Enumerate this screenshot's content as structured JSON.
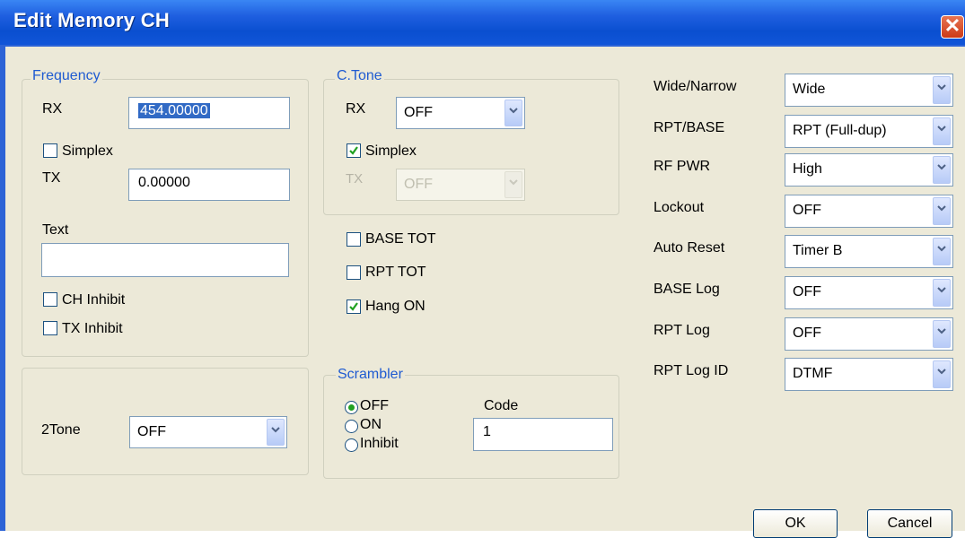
{
  "window": {
    "title": "Edit Memory CH",
    "close_glyph": "✕"
  },
  "frequency": {
    "label": "Frequency",
    "rx_label": "RX",
    "rx_value": "454.00000",
    "simplex_label": "Simplex",
    "simplex_checked": false,
    "tx_label": "TX",
    "tx_value": "0.00000",
    "text_label": "Text",
    "text_value": "",
    "ch_inhibit_label": "CH Inhibit",
    "ch_inhibit_checked": false,
    "tx_inhibit_label": "TX Inhibit",
    "tx_inhibit_checked": false
  },
  "ctone": {
    "label": "C.Tone",
    "rx_label": "RX",
    "rx_value": "OFF",
    "simplex_label": "Simplex",
    "simplex_checked": true,
    "tx_label": "TX",
    "tx_value": "OFF"
  },
  "options": {
    "base_tot_label": "BASE TOT",
    "base_tot_checked": false,
    "rpt_tot_label": "RPT TOT",
    "rpt_tot_checked": false,
    "hang_on_label": "Hang ON",
    "hang_on_checked": true
  },
  "twotone": {
    "label": "2Tone",
    "value": "OFF"
  },
  "scrambler": {
    "label": "Scrambler",
    "options": [
      "OFF",
      "ON",
      "Inhibit"
    ],
    "selected": "OFF",
    "code_label": "Code",
    "code_value": "1"
  },
  "settings": [
    {
      "label": "Wide/Narrow",
      "value": "Wide"
    },
    {
      "label": "RPT/BASE",
      "value": "RPT (Full-dup)"
    },
    {
      "label": "RF PWR",
      "value": "High"
    },
    {
      "label": "Lockout",
      "value": "OFF"
    },
    {
      "label": "Auto Reset",
      "value": "Timer B"
    },
    {
      "label": "BASE Log",
      "value": "OFF"
    },
    {
      "label": "RPT Log",
      "value": "OFF"
    },
    {
      "label": "RPT Log ID",
      "value": "DTMF"
    }
  ],
  "buttons": {
    "ok": "OK",
    "cancel": "Cancel"
  },
  "icons": {
    "dropdown": "chevron-down-icon",
    "check": "checkmark-icon",
    "close": "close-icon"
  },
  "colors": {
    "titlebar": "#0a4fd0",
    "dialog_bg": "#ece9d8",
    "group_label": "#1f5bd1",
    "selection": "#316ac5",
    "checkmark": "#21a121",
    "close_button": "#cc3a17"
  }
}
